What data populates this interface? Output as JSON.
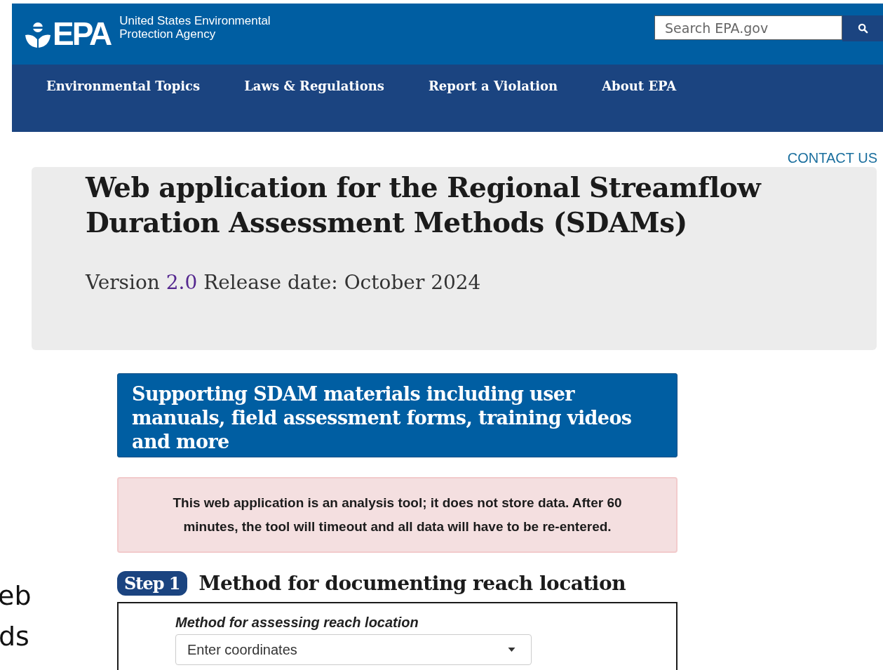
{
  "header": {
    "agency_name": "United States Environmental",
    "agency_name_line2": "Protection Agency",
    "logo_text": "EPA",
    "search": {
      "placeholder": "Search EPA.gov"
    }
  },
  "nav": [
    {
      "label": "Environmental Topics"
    },
    {
      "label": "Laws & Regulations"
    },
    {
      "label": "Report a Violation"
    },
    {
      "label": "About EPA"
    }
  ],
  "contact_link": "CONTACT US",
  "hero": {
    "title": "Web application for the Regional Streamflow Duration Assessment Methods (SDAMs)",
    "version_label": "Version",
    "version_link": "2.0",
    "release": "Release date: October 2024"
  },
  "materials_button": "Supporting SDAM materials including user manuals, field assessment forms, training videos and more",
  "notice": "This web application is an analysis tool; it does not store data. After 60 minutes, the tool will timeout and all data will have to be re-entered.",
  "slide_fragments": [
    "eb",
    "ds"
  ],
  "step": {
    "badge": "Step 1",
    "title": "Method for documenting reach location",
    "field_label": "Method for assessing reach location",
    "select_value": "Enter coordinates"
  }
}
